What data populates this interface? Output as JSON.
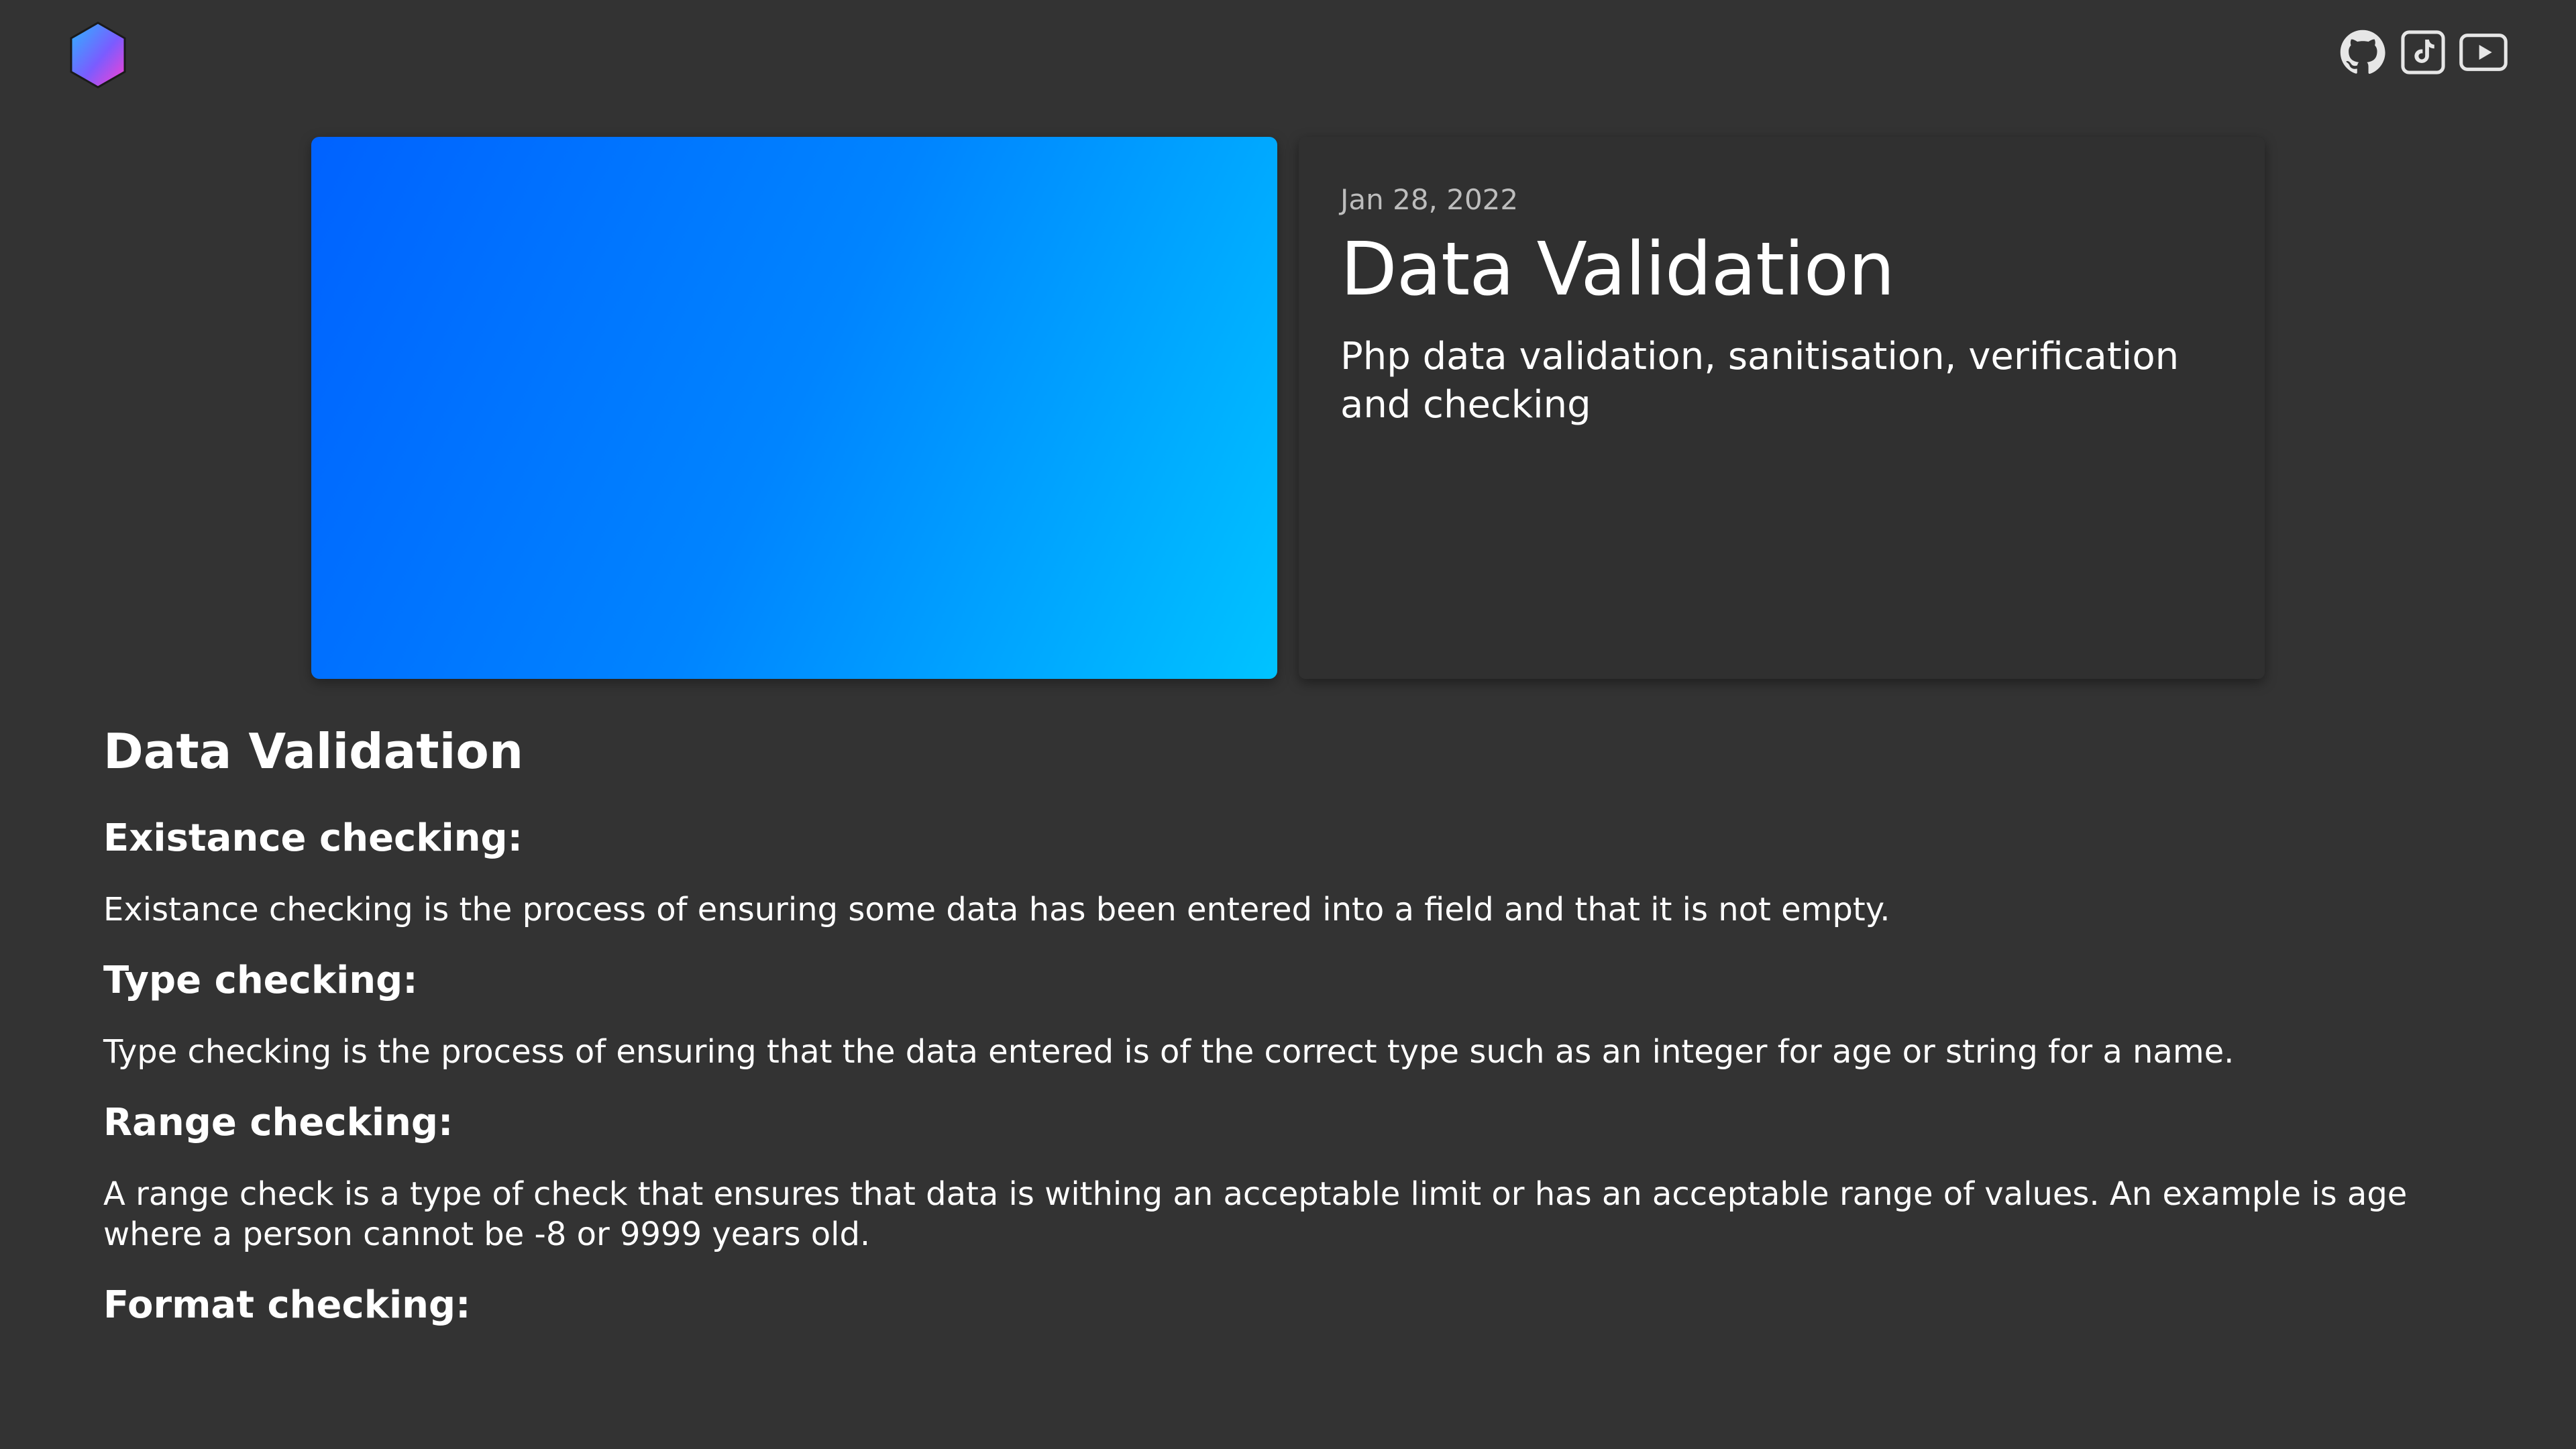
{
  "header": {
    "logo_icon": "hexagon-gradient-logo",
    "social_icons": [
      "github-icon",
      "tiktok-icon",
      "youtube-icon"
    ]
  },
  "hero": {
    "date": "Jan 28, 2022",
    "title": "Data Validation",
    "description": "Php data validation, sanitisation, verification and checking",
    "image_gradient": [
      "#0062ff",
      "#00c3ff"
    ]
  },
  "article": {
    "heading": "Data Validation",
    "sections": [
      {
        "title": "Existance checking:",
        "body": "Existance checking is the process of ensuring some data has been entered into a field and that it is not empty."
      },
      {
        "title": "Type checking:",
        "body": "Type checking is the process of ensuring that the data entered is of the correct type such as an integer for age or string for a name."
      },
      {
        "title": "Range checking:",
        "body": "A range check is a type of check that ensures that data is withing an acceptable limit or has an acceptable range of values. An example is age where a person cannot be -8 or 9999 years old."
      },
      {
        "title": "Format checking:",
        "body": ""
      }
    ]
  },
  "colors": {
    "background": "#333333",
    "card": "#303030",
    "text": "#ffffff",
    "muted": "#bdbdbd"
  }
}
